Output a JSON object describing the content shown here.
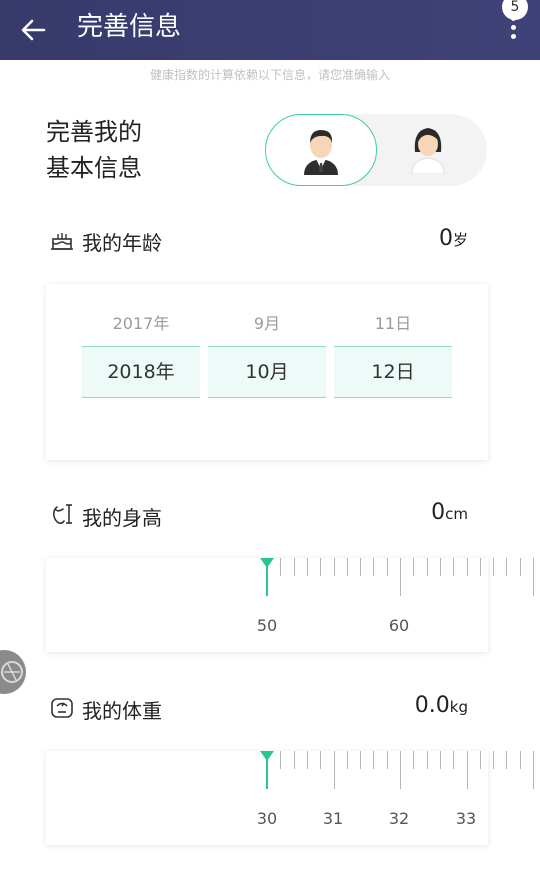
{
  "header": {
    "title": "完善信息",
    "badge": "5"
  },
  "hint": "健康指数的计算依赖以下信息，请您准确输入",
  "basic": {
    "line1": "完善我的",
    "line2": "基本信息"
  },
  "age": {
    "label": "我的年龄",
    "value": "0",
    "unit": "岁",
    "picker": {
      "prev": [
        "2017年",
        "9月",
        "11日"
      ],
      "selected": [
        "2018年",
        "10月",
        "12日"
      ]
    }
  },
  "height": {
    "label": "我的身高",
    "value": "0",
    "unit": "cm",
    "ruler_labels": [
      "50",
      "60"
    ]
  },
  "weight": {
    "label": "我的体重",
    "value": "0.0",
    "unit": "kg",
    "ruler_labels": [
      "30",
      "31",
      "32",
      "33"
    ]
  },
  "colors": {
    "header": "#3a3d6f",
    "accent": "#2bc592"
  }
}
